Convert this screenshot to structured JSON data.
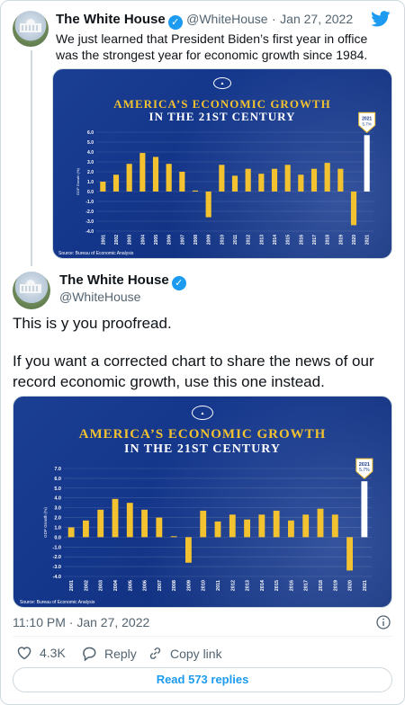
{
  "tweet1": {
    "name": "The White House",
    "handle": "@WhiteHouse",
    "sep": "·",
    "date": "Jan 27, 2022",
    "text": "We just learned that President Biden’s first year in office was the strongest year for economic growth since 1984."
  },
  "tweet2": {
    "name": "The White House",
    "handle": "@WhiteHouse",
    "text_line1": "This is y you proofread.",
    "text_line2": "If you want a corrected chart to share the news of our record economic growth, use this one instead.",
    "timestamp": "11:10 PM · Jan 27, 2022",
    "likes": "4.3K",
    "reply_label": "Reply",
    "copy_label": "Copy link",
    "read_replies": "Read 573 replies"
  },
  "chart_common": {
    "title_line1": "America’s Economic Growth",
    "title_line2": "In the 21st Century",
    "ylabel": "GDP Growth (%)",
    "source": "Source: Bureau of Economic Analysis",
    "seal_text": "THE WHITE HOUSE",
    "callout_year": "2021",
    "callout_value": "5.7%"
  },
  "chart_data": [
    {
      "type": "bar",
      "title": "America’s Economic Growth In the 21st Century",
      "ylabel": "GDP Growth (%)",
      "categories": [
        "2001",
        "2002",
        "2003",
        "2004",
        "2005",
        "2006",
        "2007",
        "2008",
        "2009",
        "2010",
        "2011",
        "2012",
        "2013",
        "2014",
        "2015",
        "2016",
        "2017",
        "2018",
        "2019",
        "2020",
        "2021"
      ],
      "values": [
        1.0,
        1.7,
        2.8,
        3.9,
        3.5,
        2.8,
        2.0,
        0.1,
        -2.6,
        2.7,
        1.6,
        2.3,
        1.8,
        2.3,
        2.7,
        1.7,
        2.3,
        2.9,
        2.3,
        -3.4,
        5.7
      ],
      "yticks": [
        "6.0",
        "5.0",
        "4.0",
        "3.0",
        "2.0",
        "1.0",
        "0.0",
        "-1.0",
        "-2.0",
        "-3.0",
        "-4.0"
      ],
      "ylim": [
        -4.0,
        6.0
      ],
      "highlight": "2021"
    },
    {
      "type": "bar",
      "title": "America’s Economic Growth In the 21st Century",
      "ylabel": "GDP Growth (%)",
      "categories": [
        "2001",
        "2002",
        "2003",
        "2004",
        "2005",
        "2006",
        "2007",
        "2008",
        "2009",
        "2010",
        "2011",
        "2012",
        "2013",
        "2014",
        "2015",
        "2016",
        "2017",
        "2018",
        "2019",
        "2020",
        "2021"
      ],
      "values": [
        1.0,
        1.7,
        2.8,
        3.9,
        3.5,
        2.8,
        2.0,
        0.1,
        -2.6,
        2.7,
        1.6,
        2.3,
        1.8,
        2.3,
        2.7,
        1.7,
        2.3,
        2.9,
        2.3,
        -3.4,
        5.7
      ],
      "yticks": [
        "7.0",
        "6.0",
        "5.0",
        "4.0",
        "3.0",
        "2.0",
        "1.0",
        "0.0",
        "-1.0",
        "-2.0",
        "-3.0",
        "-4.0"
      ],
      "ylim": [
        -4.0,
        7.0
      ],
      "highlight": "2021"
    }
  ],
  "colors": {
    "bar": "#f2c230",
    "highlight": "#ffffff",
    "card": "#16398b",
    "link": "#1d9bf0"
  },
  "icons": [
    "verified-badge-icon",
    "twitter-bird-icon",
    "heart-icon",
    "reply-icon",
    "link-icon",
    "info-icon"
  ]
}
